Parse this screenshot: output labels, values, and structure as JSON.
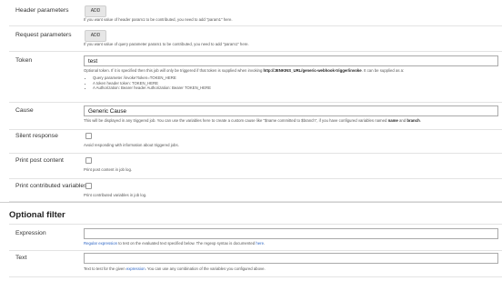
{
  "header_params": {
    "label": "Header parameters",
    "button": "ADD",
    "help": "If you want value of header param1 to be contributed, you need to add \"param1\" here."
  },
  "request_params": {
    "label": "Request parameters",
    "button": "ADD",
    "help": "If you want value of query parameter param1 to be contributed, you need to add \"param1\" here."
  },
  "token": {
    "label": "Token",
    "value": "test",
    "help_prefix": "Optional token. If it is specified then this job will only be triggered if that token is supplied when invoking ",
    "help_url": "http://JENKINS_URL/generic-webhook-trigger/invoke",
    "help_suffix": ". It can be supplied as a:",
    "items": [
      "Query parameter /invoke?token=TOKEN_HERE",
      "A token header token: TOKEN_HERE",
      "A Authorization: Bearer header Authorization: Bearer TOKEN_HERE"
    ]
  },
  "cause": {
    "label": "Cause",
    "value": "Generic Cause",
    "help_prefix": "This will be displayed in any triggered job. You can use the variables here to create a custom cause like \"$name committed to $branch\", if you have configured variables named ",
    "help_bold1": "name",
    "help_mid": " and ",
    "help_bold2": "branch",
    "help_suffix": "."
  },
  "silent": {
    "label": "Silent response",
    "help": "Avoid responding with information about triggered jobs."
  },
  "print_post": {
    "label": "Print post content",
    "help": "Print post content in job log."
  },
  "print_vars": {
    "label": "Print contributed variables",
    "help": "Print contributed variables in job log."
  },
  "optional_filter": {
    "title": "Optional filter"
  },
  "expression": {
    "label": "Expression",
    "value": "",
    "help_link": "Regular expression",
    "help_mid": " to test on the evaluated text specified below. The regexp syntax is documented ",
    "help_link2": "here",
    "help_suffix": "."
  },
  "text": {
    "label": "Text",
    "value": "",
    "help_prefix": "Text to test for the given ",
    "help_link": "expression",
    "help_suffix": ". You can use any combination of the variables you configured above."
  }
}
